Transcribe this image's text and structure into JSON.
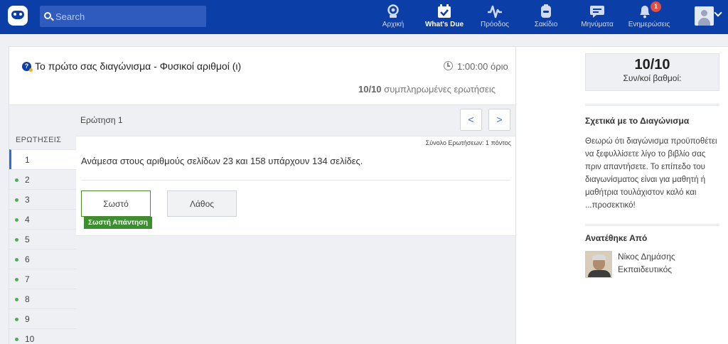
{
  "header": {
    "search_placeholder": "Search",
    "nav": [
      {
        "label": "Αρχική",
        "icon": "home-icon"
      },
      {
        "label": "What's Due",
        "icon": "calendar-check-icon"
      },
      {
        "label": "Πρόοδος",
        "icon": "pulse-icon"
      },
      {
        "label": "Σακίδιο",
        "icon": "backpack-icon"
      },
      {
        "label": "Μηνύματα",
        "icon": "chat-icon"
      },
      {
        "label": "Ενημερώσεις",
        "icon": "notifications-icon",
        "badge": "1"
      }
    ]
  },
  "quiz": {
    "title": "Το πρώτο σας διαγώνισμα - Φυσικοί αριθμοί (ι)",
    "time_limit": "1:00:00 όριο",
    "completed_count": "10/10",
    "completed_text": "συμπληρωμένες ερωτήσεις",
    "questions_header": "ΕΡΩΤΗΣΕΙΣ",
    "questions": [
      "1",
      "2",
      "3",
      "4",
      "5",
      "6",
      "7",
      "8",
      "9",
      "10"
    ],
    "active_question": "1",
    "question_label": "Ερώτηση 1",
    "prev_label": "<",
    "next_label": ">",
    "total_points": "Σύνολο Ερωτήσεων: 1 πόντος",
    "question_text": "Ανάμεσα στους αριθμούς σελίδων 23 και 158 υπάρχουν 134 σελίδες.",
    "answers": [
      "Σωστό",
      "Λάθος"
    ],
    "correct_tag": "Σωστή Απάντηση"
  },
  "sidebar": {
    "score_value": "10/10",
    "score_label": "Συν/κοί βαθμοί:",
    "about_title": "Σχετικά με το Διαγώνισμα",
    "about_text": "Θεωρώ ότι διαγώνισμα προϋποθέτει να ξεφυλλίσετε λίγο το βιβλίο σας πριν απαντήσετε. Το επίπεδο του διαγωνίσματος είναι για μαθητή ή μαθήτρια τουλάχιστον καλό και ...προσεκτικό!",
    "posted_by_title": "Ανατέθηκε Από",
    "author_name": "Νίκος Δημάσης",
    "author_role": "Εκπαιδευτικός"
  },
  "colors": {
    "topbar": "#0b3ea7",
    "accent": "#2a6fdb",
    "correct": "#3b8f2f",
    "badge": "#e74c3c"
  }
}
